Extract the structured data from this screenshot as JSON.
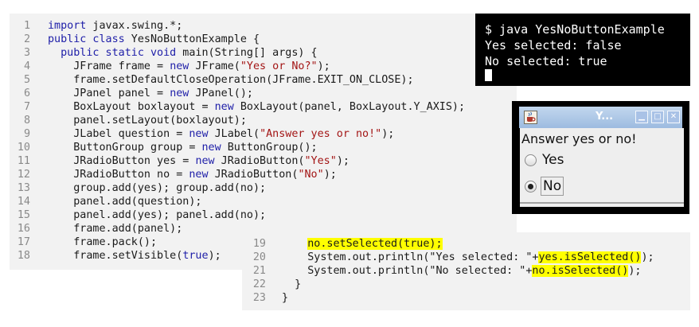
{
  "code_main": {
    "lines": [
      {
        "n": "1",
        "segs": [
          {
            "t": "import",
            "c": "kw"
          },
          {
            "t": " javax.swing.*;"
          }
        ]
      },
      {
        "n": "2",
        "segs": [
          {
            "t": "public class",
            "c": "kw"
          },
          {
            "t": " YesNoButtonExample {"
          }
        ]
      },
      {
        "n": "3",
        "segs": [
          {
            "t": "  public static void",
            "c": "kw"
          },
          {
            "t": " main(String[] args) {"
          }
        ]
      },
      {
        "n": "4",
        "segs": [
          {
            "t": "    JFrame frame = "
          },
          {
            "t": "new",
            "c": "kw"
          },
          {
            "t": " JFrame("
          },
          {
            "t": "\"Yes or No?\"",
            "c": "str"
          },
          {
            "t": ");"
          }
        ]
      },
      {
        "n": "5",
        "segs": [
          {
            "t": "    frame.setDefaultCloseOperation(JFrame.EXIT_ON_CLOSE);"
          }
        ]
      },
      {
        "n": "6",
        "segs": [
          {
            "t": "    JPanel panel = "
          },
          {
            "t": "new",
            "c": "kw"
          },
          {
            "t": " JPanel();"
          }
        ]
      },
      {
        "n": "7",
        "segs": [
          {
            "t": "    BoxLayout boxlayout = "
          },
          {
            "t": "new",
            "c": "kw"
          },
          {
            "t": " BoxLayout(panel, BoxLayout.Y_AXIS);"
          }
        ]
      },
      {
        "n": "8",
        "segs": [
          {
            "t": "    panel.setLayout(boxlayout);"
          }
        ]
      },
      {
        "n": "9",
        "segs": [
          {
            "t": "    JLabel question = "
          },
          {
            "t": "new",
            "c": "kw"
          },
          {
            "t": " JLabel("
          },
          {
            "t": "\"Answer yes or no!\"",
            "c": "str"
          },
          {
            "t": ");"
          }
        ]
      },
      {
        "n": "10",
        "segs": [
          {
            "t": "    ButtonGroup group = "
          },
          {
            "t": "new",
            "c": "kw"
          },
          {
            "t": " ButtonGroup();"
          }
        ]
      },
      {
        "n": "11",
        "segs": [
          {
            "t": "    JRadioButton yes = "
          },
          {
            "t": "new",
            "c": "kw"
          },
          {
            "t": " JRadioButton("
          },
          {
            "t": "\"Yes\"",
            "c": "str"
          },
          {
            "t": ");"
          }
        ]
      },
      {
        "n": "12",
        "segs": [
          {
            "t": "    JRadioButton no = "
          },
          {
            "t": "new",
            "c": "kw"
          },
          {
            "t": " JRadioButton("
          },
          {
            "t": "\"No\"",
            "c": "str"
          },
          {
            "t": ");"
          }
        ]
      },
      {
        "n": "13",
        "segs": [
          {
            "t": "    group.add(yes); group.add(no);"
          }
        ]
      },
      {
        "n": "14",
        "segs": [
          {
            "t": "    panel.add(question);"
          }
        ]
      },
      {
        "n": "15",
        "segs": [
          {
            "t": "    panel.add(yes); panel.add(no);"
          }
        ]
      },
      {
        "n": "16",
        "segs": [
          {
            "t": "    frame.add(panel);"
          }
        ]
      },
      {
        "n": "17",
        "segs": [
          {
            "t": "    frame.pack();"
          }
        ]
      },
      {
        "n": "18",
        "segs": [
          {
            "t": "    frame.setVisible("
          },
          {
            "t": "true",
            "c": "kw"
          },
          {
            "t": ");"
          }
        ]
      }
    ]
  },
  "code_ext": {
    "lines": [
      {
        "n": "19",
        "segs": [
          {
            "t": "    "
          },
          {
            "t": "no.setSelected(true);",
            "c": "hl"
          }
        ]
      },
      {
        "n": "20",
        "segs": [
          {
            "t": "    System.out.println(\"Yes selected: \"+"
          },
          {
            "t": "yes.isSelected()",
            "c": "hl"
          },
          {
            "t": ");"
          }
        ]
      },
      {
        "n": "21",
        "segs": [
          {
            "t": "    System.out.println(\"No selected: \"+"
          },
          {
            "t": "no.isSelected()",
            "c": "hl"
          },
          {
            "t": ");"
          }
        ]
      },
      {
        "n": "22",
        "segs": [
          {
            "t": "  }"
          }
        ]
      },
      {
        "n": "23",
        "segs": [
          {
            "t": "}"
          }
        ]
      }
    ]
  },
  "terminal": {
    "lines": [
      "$ java YesNoButtonExample",
      "Yes selected: false",
      "No selected: true"
    ]
  },
  "swing_window": {
    "title": "Y...",
    "min_glyph": "▁",
    "max_glyph": "□",
    "close_glyph": "✕",
    "question": "Answer yes or no!",
    "yes_label": "Yes",
    "no_label": "No",
    "yes_selected": false,
    "no_selected": true,
    "title_color": "#9dbbe0",
    "window_icon": "java-cup-icon"
  }
}
